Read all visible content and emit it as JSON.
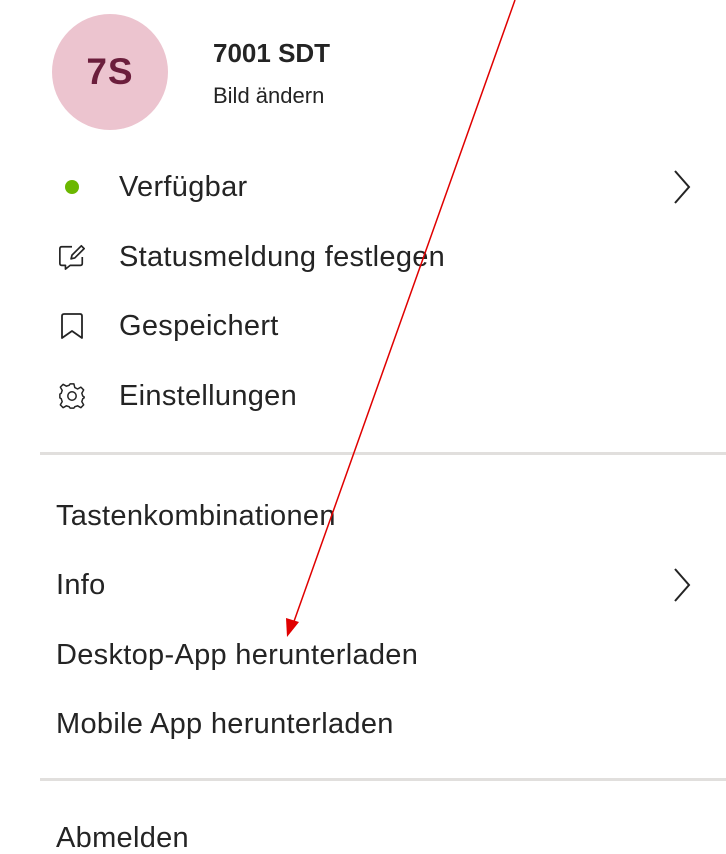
{
  "profile": {
    "initials": "7S",
    "name": "7001 SDT",
    "change_picture": "Bild ändern"
  },
  "status_section": {
    "items": [
      {
        "label": "Verfügbar",
        "icon": "available-dot-icon",
        "has_chevron": true
      },
      {
        "label": "Statusmeldung festlegen",
        "icon": "status-message-icon",
        "has_chevron": false
      },
      {
        "label": "Gespeichert",
        "icon": "bookmark-icon",
        "has_chevron": false
      },
      {
        "label": "Einstellungen",
        "icon": "gear-icon",
        "has_chevron": false
      }
    ]
  },
  "links_section": {
    "items": [
      {
        "label": "Tastenkombinationen",
        "has_chevron": false
      },
      {
        "label": "Info",
        "has_chevron": true
      },
      {
        "label": "Desktop-App herunterladen",
        "has_chevron": false
      },
      {
        "label": "Mobile App herunterladen",
        "has_chevron": false
      }
    ]
  },
  "signout": {
    "label": "Abmelden"
  },
  "colors": {
    "avatar_bg": "#ecc4cf",
    "avatar_text": "#6b1e3c",
    "available_green": "#6bb700",
    "divider": "#e1dfdd",
    "annotation_arrow": "#e00000"
  }
}
